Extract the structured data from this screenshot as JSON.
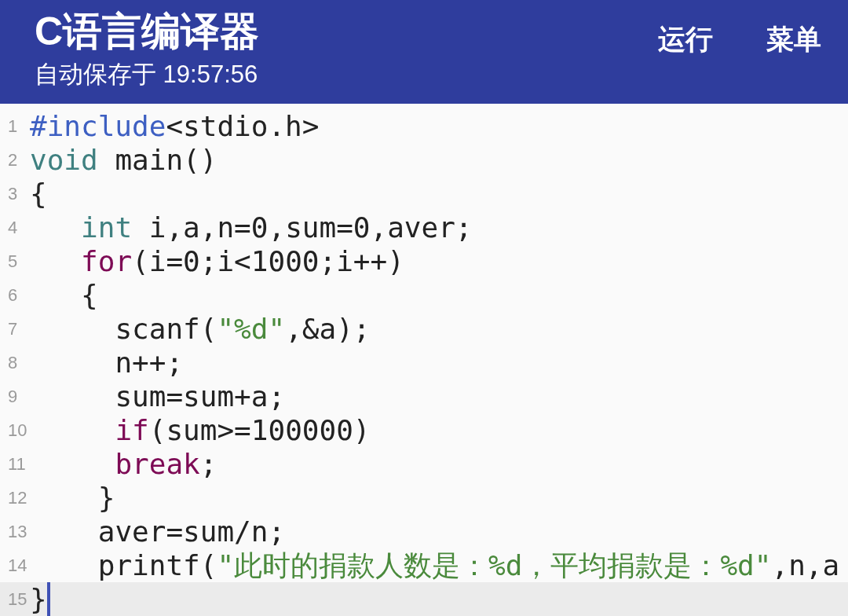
{
  "app_bar": {
    "title": "C语言编译器",
    "subtitle": "自动保存于 19:57:56",
    "actions": [
      "运行",
      "菜单"
    ]
  },
  "editor": {
    "lines": [
      {
        "number": "1",
        "current": false,
        "tokens": [
          {
            "kind": "preprocessor",
            "text": "#include"
          },
          {
            "kind": "plain",
            "text": "<stdio.h>"
          }
        ]
      },
      {
        "number": "2",
        "current": false,
        "tokens": [
          {
            "kind": "type",
            "text": "void"
          },
          {
            "kind": "plain",
            "text": " main()"
          }
        ]
      },
      {
        "number": "3",
        "current": false,
        "tokens": [
          {
            "kind": "plain",
            "text": "{"
          }
        ]
      },
      {
        "number": "4",
        "current": false,
        "tokens": [
          {
            "kind": "type",
            "text": "   int"
          },
          {
            "kind": "plain",
            "text": " i,a,n=0,sum=0,aver;"
          }
        ]
      },
      {
        "number": "5",
        "current": false,
        "tokens": [
          {
            "kind": "keyword",
            "text": "   for"
          },
          {
            "kind": "plain",
            "text": "(i=0;i<1000;i++)"
          }
        ]
      },
      {
        "number": "6",
        "current": false,
        "tokens": [
          {
            "kind": "plain",
            "text": "   {"
          }
        ]
      },
      {
        "number": "7",
        "current": false,
        "tokens": [
          {
            "kind": "plain",
            "text": "     scanf("
          },
          {
            "kind": "string",
            "text": "\"%d\""
          },
          {
            "kind": "plain",
            "text": ",&a);"
          }
        ]
      },
      {
        "number": "8",
        "current": false,
        "tokens": [
          {
            "kind": "plain",
            "text": "     n++;"
          }
        ]
      },
      {
        "number": "9",
        "current": false,
        "tokens": [
          {
            "kind": "plain",
            "text": "     sum=sum+a;"
          }
        ]
      },
      {
        "number": "10",
        "current": false,
        "tokens": [
          {
            "kind": "keyword",
            "text": "     if"
          },
          {
            "kind": "plain",
            "text": "(sum>=100000)"
          }
        ]
      },
      {
        "number": "11",
        "current": false,
        "tokens": [
          {
            "kind": "keyword",
            "text": "     break"
          },
          {
            "kind": "plain",
            "text": ";"
          }
        ]
      },
      {
        "number": "12",
        "current": false,
        "tokens": [
          {
            "kind": "plain",
            "text": "    }"
          }
        ]
      },
      {
        "number": "13",
        "current": false,
        "tokens": [
          {
            "kind": "plain",
            "text": "    aver=sum/n;"
          }
        ]
      },
      {
        "number": "14",
        "current": false,
        "tokens": [
          {
            "kind": "plain",
            "text": "    printf("
          },
          {
            "kind": "string",
            "text": "\"此时的捐款人数是：%d，平均捐款是：%d\""
          },
          {
            "kind": "plain",
            "text": ",n,a"
          }
        ]
      },
      {
        "number": "15",
        "current": true,
        "tokens": [
          {
            "kind": "plain",
            "text": "}"
          }
        ]
      }
    ]
  }
}
